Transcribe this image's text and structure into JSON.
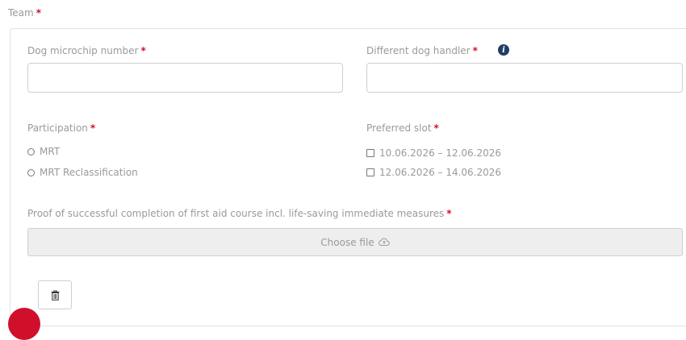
{
  "team": {
    "label": "Team",
    "required": "*"
  },
  "fields": {
    "microchip": {
      "label": "Dog microchip number",
      "required": "*",
      "value": ""
    },
    "handler": {
      "label": "Different dog handler",
      "required": "*",
      "value": "",
      "info_icon": "info-icon"
    }
  },
  "participation": {
    "label": "Participation",
    "required": "*",
    "options": [
      "MRT",
      "MRT Reclassification"
    ]
  },
  "slot": {
    "label": "Preferred slot",
    "required": "*",
    "options": [
      "10.06.2026 – 12.06.2026",
      "12.06.2026 – 14.06.2026"
    ]
  },
  "proof": {
    "label": "Proof of successful completion of first aid course incl. life-saving immediate measures",
    "required": "*",
    "button": "Choose file",
    "button_icon": "cloud-upload-icon"
  },
  "delete": {
    "icon": "trash-icon"
  },
  "colors": {
    "required": "#d0102b",
    "info": "#1f3e66",
    "text": "#9a9a9a",
    "border": "#cfcfcf"
  }
}
